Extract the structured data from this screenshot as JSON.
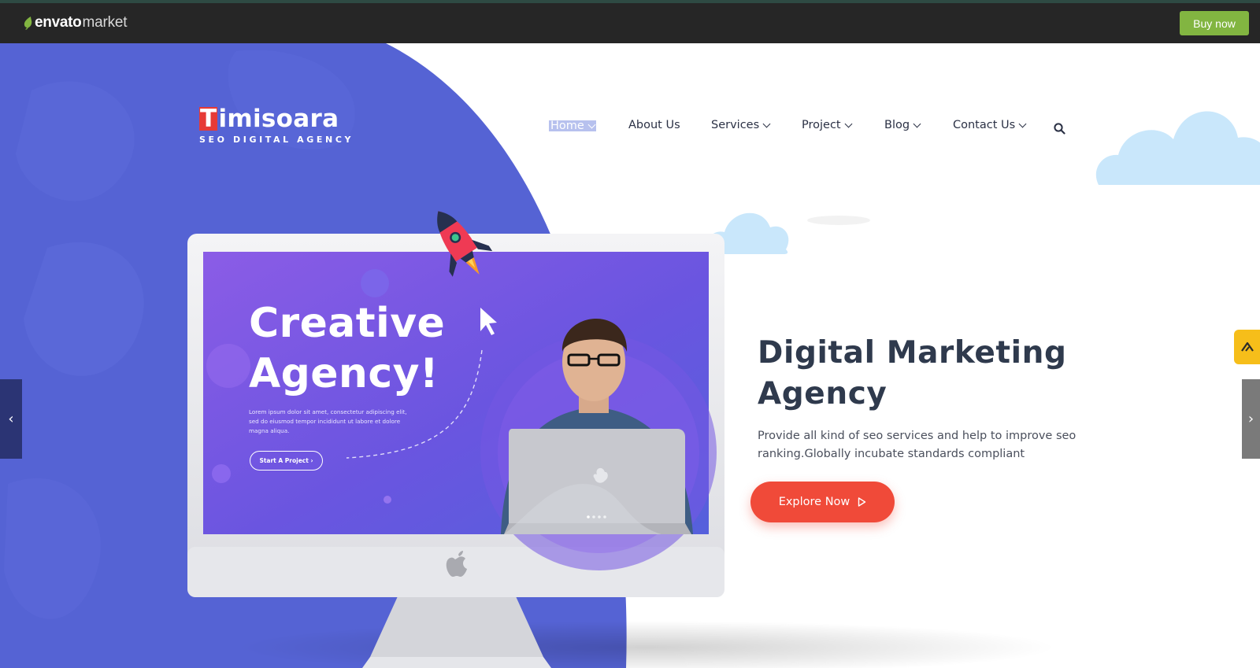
{
  "envato_bar": {
    "brand": "envato",
    "market": "market",
    "buy_now_label": "Buy now"
  },
  "brand": {
    "first_letter": "T",
    "rest": "imisoara",
    "tagline": "SEO DIGITAL AGENCY"
  },
  "nav": {
    "items": [
      {
        "label": "Home",
        "active": true
      },
      {
        "label": "About Us"
      },
      {
        "label": "Services"
      },
      {
        "label": "Project"
      },
      {
        "label": "Blog"
      },
      {
        "label": "Contact Us"
      }
    ],
    "search_icon": "search-icon"
  },
  "hero": {
    "headline_line1": "Digital Marketing",
    "headline_line2": "Agency",
    "subtext": "Provide all kind of seo services and help to improve seo ranking.Globally incubate standards compliant",
    "cta_label": "Explore Now",
    "cta_icon": "play-triangle-icon"
  },
  "screen": {
    "title_line1": "Creative",
    "title_line2": "Agency!",
    "lorem": "Lorem ipsum dolor sit amet, consectetur adipiscing elit, sed do eiusmod tempor incididunt ut labore et dolore magna aliqua.",
    "button_label": "Start A Project"
  },
  "slider": {
    "prev_glyph": "‹",
    "next_glyph": "›"
  },
  "colors": {
    "envato_bar": "#262626",
    "buy_now": "#82b541",
    "hero_blue": "#5563d4",
    "cta_red": "#f04a39",
    "headline": "#2f3a4d"
  }
}
